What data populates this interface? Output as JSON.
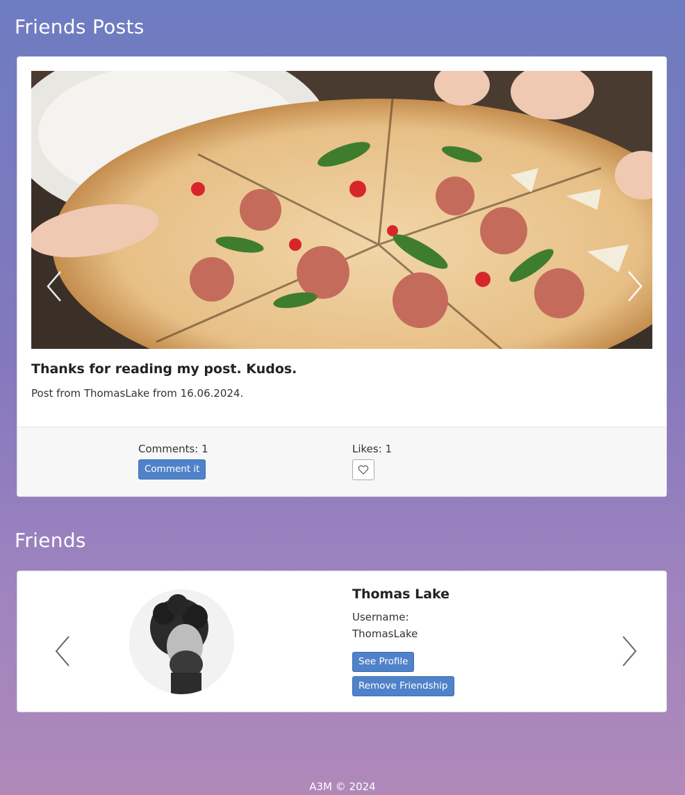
{
  "sections": {
    "posts_title": "Friends Posts",
    "friends_title": "Friends"
  },
  "post": {
    "title": "Thanks for reading my post. Kudos.",
    "meta": "Post from ThomasLake from 16.06.2024.",
    "comments_label": "Comments: 1",
    "comment_button": "Comment it",
    "likes_label": "Likes: 1",
    "like_icon": "heart-outline-icon"
  },
  "friend": {
    "name": "Thomas Lake",
    "username_label": "Username:",
    "username": "ThomasLake",
    "see_profile_button": "See Profile",
    "remove_button": "Remove Friendship"
  },
  "footer": {
    "text": "A3M © 2024"
  },
  "colors": {
    "accent": "#4f82c9",
    "background_top": "#6e7cc1",
    "background_bottom": "#b089b9"
  }
}
